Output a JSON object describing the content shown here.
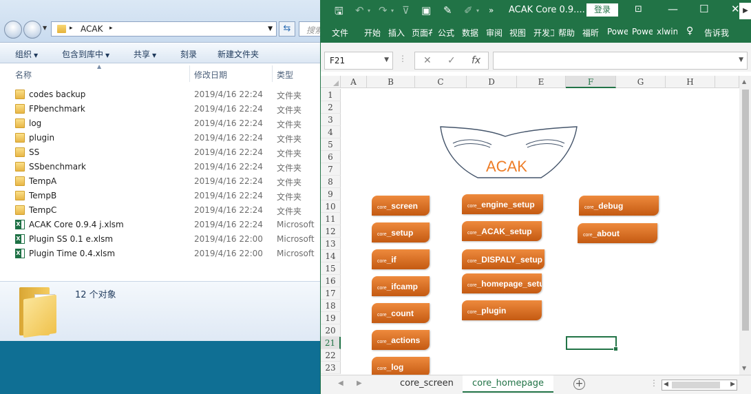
{
  "explorer": {
    "address": {
      "path": "ACAK",
      "search_placeholder": "搜索"
    },
    "toolbar": {
      "organize": "组织",
      "include_library": "包含到库中",
      "share": "共享",
      "burn": "刻录",
      "new_folder": "新建文件夹"
    },
    "columns": {
      "name": "名称",
      "modified": "修改日期",
      "type": "类型"
    },
    "files": [
      {
        "name": "codes backup",
        "date": "2019/4/16 22:24",
        "type": "文件夹",
        "kind": "folder"
      },
      {
        "name": "FPbenchmark",
        "date": "2019/4/16 22:24",
        "type": "文件夹",
        "kind": "folder"
      },
      {
        "name": "log",
        "date": "2019/4/16 22:24",
        "type": "文件夹",
        "kind": "folder"
      },
      {
        "name": "plugin",
        "date": "2019/4/16 22:24",
        "type": "文件夹",
        "kind": "folder"
      },
      {
        "name": "SS",
        "date": "2019/4/16 22:24",
        "type": "文件夹",
        "kind": "folder"
      },
      {
        "name": "SSbenchmark",
        "date": "2019/4/16 22:24",
        "type": "文件夹",
        "kind": "folder"
      },
      {
        "name": "TempA",
        "date": "2019/4/16 22:24",
        "type": "文件夹",
        "kind": "folder"
      },
      {
        "name": "TempB",
        "date": "2019/4/16 22:24",
        "type": "文件夹",
        "kind": "folder"
      },
      {
        "name": "TempC",
        "date": "2019/4/16 22:24",
        "type": "文件夹",
        "kind": "folder"
      },
      {
        "name": "ACAK Core 0.9.4 j.xlsm",
        "date": "2019/4/16 22:24",
        "type": "Microsoft",
        "kind": "excel"
      },
      {
        "name": "Plugin SS 0.1 e.xlsm",
        "date": "2019/4/16 22:00",
        "type": "Microsoft",
        "kind": "excel"
      },
      {
        "name": "Plugin Time 0.4.xlsm",
        "date": "2019/4/16 22:00",
        "type": "Microsoft",
        "kind": "excel"
      }
    ],
    "status": {
      "count": "12 个对象"
    }
  },
  "excel": {
    "title": "ACAK Core 0.9....",
    "login": "登录",
    "ribbon_tabs": [
      "文件",
      "开始",
      "插入",
      "页面布",
      "公式",
      "数据",
      "审阅",
      "视图",
      "开发工",
      "帮助",
      "福昕",
      "Powe",
      "Powe",
      "xlwin",
      "告诉我"
    ],
    "name_box": "F21",
    "formula": "",
    "columns": [
      "A",
      "B",
      "C",
      "D",
      "E",
      "F",
      "G",
      "H"
    ],
    "selected_column": "F",
    "rows": [
      "1",
      "2",
      "3",
      "4",
      "5",
      "6",
      "7",
      "8",
      "9",
      "10",
      "11",
      "12",
      "13",
      "14",
      "15",
      "16",
      "17",
      "18",
      "19",
      "20",
      "21",
      "22",
      "23"
    ],
    "selected_row": "21",
    "logo_text": "ACAK",
    "buttons": [
      {
        "prefix": "core",
        "label": "_screen"
      },
      {
        "prefix": "core",
        "label": "_setup"
      },
      {
        "prefix": "core",
        "label": "_if"
      },
      {
        "prefix": "core",
        "label": "_ifcamp"
      },
      {
        "prefix": "core",
        "label": "_count"
      },
      {
        "prefix": "core",
        "label": "_actions"
      },
      {
        "prefix": "core",
        "label": "_log"
      },
      {
        "prefix": "core",
        "label": "_engine_setup"
      },
      {
        "prefix": "core",
        "label": "_ACAK_setup"
      },
      {
        "prefix": "core",
        "label": "_DISPALY_setup"
      },
      {
        "prefix": "core",
        "label": "_homepage_setu"
      },
      {
        "prefix": "core",
        "label": "_plugin"
      },
      {
        "prefix": "core",
        "label": "_debug"
      },
      {
        "prefix": "core",
        "label": "_about"
      }
    ],
    "sheets": [
      "core_screen",
      "core_homepage"
    ],
    "active_sheet": "core_homepage",
    "colors": {
      "excel_green": "#217346",
      "button_orange": "#d86a1c",
      "logo_orange": "#ee7d27",
      "logo_outline": "#44546a"
    }
  }
}
